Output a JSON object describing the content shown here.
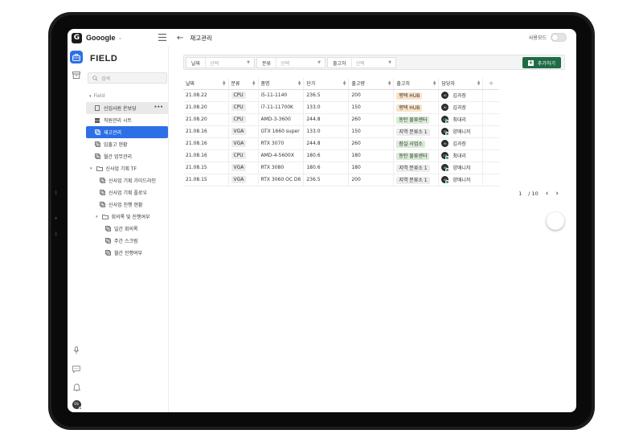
{
  "app": {
    "brand_letter": "G",
    "brand_name": "Gooogle"
  },
  "header": {
    "title": "재고관리",
    "toggle_label": "사용모드"
  },
  "sidebar": {
    "title": "FIELD",
    "search_placeholder": "검색",
    "section_label": "Field",
    "items": [
      {
        "label": "신입사원 온보딩",
        "more": "•••"
      },
      {
        "label": "직원관리 시트"
      },
      {
        "label": "재고관리"
      },
      {
        "label": "입출고 현황"
      },
      {
        "label": "월간 업무관리"
      },
      {
        "label": "신사업 기획 TF"
      },
      {
        "label": "신사업 기획 가이드라인"
      },
      {
        "label": "신사업 기획 플로우"
      },
      {
        "label": "신사업 진행 현황"
      },
      {
        "label": "회의록 및 진행여부"
      },
      {
        "label": "일간 회의록"
      },
      {
        "label": "주간 스크럼"
      },
      {
        "label": "월간 진행여부"
      }
    ],
    "avatar_initials": "SS"
  },
  "filters": [
    {
      "label": "날짜",
      "value": "선택"
    },
    {
      "label": "분류",
      "value": "선택"
    },
    {
      "label": "출고처",
      "value": "선택"
    }
  ],
  "add_button_label": "추가하기",
  "table": {
    "columns": [
      "날짜",
      "분류",
      "품명",
      "단가",
      "출고량",
      "출고처",
      "담당자"
    ],
    "add_column": "+",
    "rows": [
      [
        "21.08.22",
        "CPU",
        "i5-11-1140",
        "236.5",
        "200",
        "평택 HUB",
        "김과장"
      ],
      [
        "21.08.20",
        "CPU",
        "i7-11-11700K",
        "133.0",
        "150",
        "평택 HUB",
        "김과장"
      ],
      [
        "21.08.20",
        "CPU",
        "AMD-3-3600",
        "244.8",
        "260",
        "동탄 물류센터",
        "최대리"
      ],
      [
        "21.08.16",
        "VGA",
        "GTX 1660 super",
        "133.0",
        "150",
        "지역 분류소 1",
        "양매니저"
      ],
      [
        "21.08.16",
        "VGA",
        "RTX 3070",
        "244.8",
        "260",
        "잠실 사업소",
        "김과장"
      ],
      [
        "21.08.16",
        "CPU",
        "AMD-4-5600X",
        "180.6",
        "180",
        "동탄 물류센터",
        "최대리"
      ],
      [
        "21.08.15",
        "VGA",
        "RTX 3080",
        "180.6",
        "180",
        "지역 분류소 1",
        "양매니저"
      ],
      [
        "21.08.15",
        "VGA",
        "RTX 3060 OC D6",
        "236.5",
        "200",
        "지역 분류소 1",
        "양매니저"
      ]
    ],
    "avatars": {
      "김과장": "KI",
      "최대리": "CH",
      "양매니저": "YA"
    }
  },
  "pagination": {
    "current": "1",
    "total": "/ 10"
  },
  "colors": {
    "accent": "#2d6fe6",
    "add_button": "#1f6b46",
    "tag_orange": "#fbe3c8",
    "tag_green": "#d8ecd6",
    "tag_grey": "#ececec"
  }
}
